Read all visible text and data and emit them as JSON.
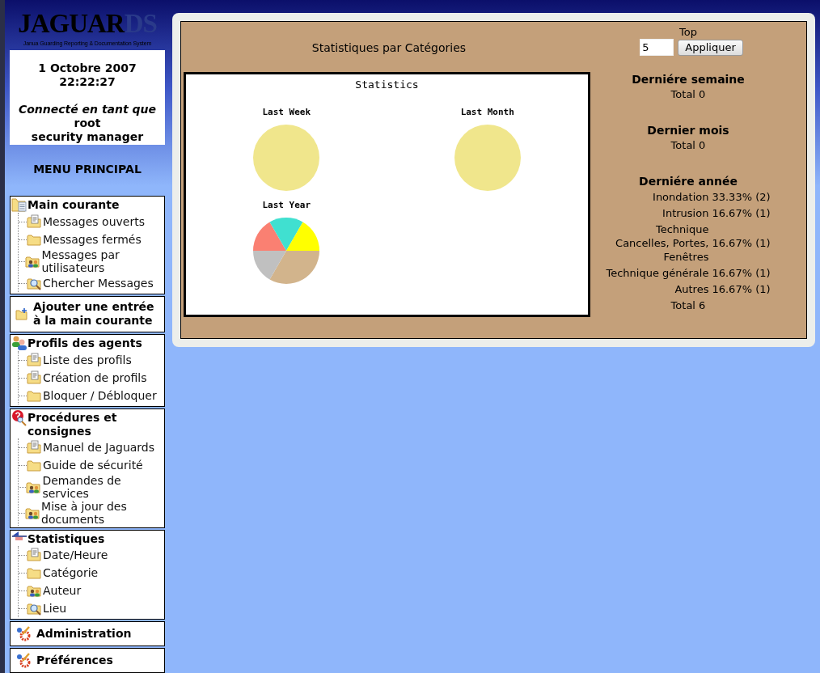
{
  "logo": {
    "main": "JAGUAR",
    "accent": "DS",
    "subtitle": "Janua Guarding Reporting & Documentation System"
  },
  "info": {
    "date": "1 Octobre 2007",
    "time": "22:22:27",
    "connected": "Connecté en tant que",
    "user": "root",
    "role": "security manager"
  },
  "menu_title": "MENU PRINCIPAL",
  "menu": [
    {
      "label": "Main courante",
      "kind": "folder-doc",
      "children": [
        {
          "label": "Messages ouverts",
          "kind": "doc"
        },
        {
          "label": "Messages fermés",
          "kind": "plain"
        },
        {
          "label": "Messages par utilisateurs",
          "kind": "users"
        },
        {
          "label": "Chercher Messages",
          "kind": "search"
        }
      ]
    },
    {
      "label": "Ajouter une entrée à la main courante",
      "kind": "folder-add"
    },
    {
      "label": "Profils des agents",
      "kind": "people",
      "children": [
        {
          "label": "Liste des profils",
          "kind": "doc"
        },
        {
          "label": "Création de profils",
          "kind": "doc"
        },
        {
          "label": "Bloquer / Débloquer",
          "kind": "plain"
        }
      ]
    },
    {
      "label": "Procédures et consignes",
      "kind": "help",
      "children": [
        {
          "label": "Manuel de Jaguards",
          "kind": "doc"
        },
        {
          "label": "Guide de sécurité",
          "kind": "plain"
        },
        {
          "label": "Demandes de services",
          "kind": "users"
        },
        {
          "label": "Mise à jour des documents",
          "kind": "users"
        }
      ]
    },
    {
      "label": "Statistiques",
      "kind": "flag",
      "children": [
        {
          "label": "Date/Heure",
          "kind": "doc"
        },
        {
          "label": "Catégorie",
          "kind": "plain"
        },
        {
          "label": "Auteur",
          "kind": "users"
        },
        {
          "label": "Lieu",
          "kind": "search"
        }
      ]
    },
    {
      "label": "Administration",
      "kind": "tools"
    },
    {
      "label": "Préférences",
      "kind": "tools"
    }
  ],
  "page_title": "Statistiques par Catégories",
  "top": {
    "label": "Top",
    "value": "5",
    "button": "Appliquer"
  },
  "chart_panel": {
    "title": "Statistics",
    "pies": [
      {
        "title": "Last Week",
        "kind": "empty"
      },
      {
        "title": "Last Month",
        "kind": "empty"
      },
      {
        "title": "Last Year",
        "kind": "chart",
        "chart_data": {
          "type": "pie",
          "values": [
            33.33,
            16.67,
            16.67,
            16.67,
            16.67
          ]
        }
      }
    ]
  },
  "summary": [
    {
      "heading": "Derniére semaine",
      "total": "Total 0"
    },
    {
      "heading": "Dernier mois",
      "total": "Total 0"
    },
    {
      "heading": "Derniére année",
      "rows": [
        {
          "category": [
            "Inondation"
          ],
          "value": "33.33% (2)"
        },
        {
          "category": [
            "Intrusion"
          ],
          "value": "16.67% (1)"
        },
        {
          "category": [
            "Technique",
            "Cancelles, Portes,",
            "Fenêtres"
          ],
          "value": "16.67% (1)"
        },
        {
          "category": [
            "Technique générale"
          ],
          "value": "16.67% (1)"
        },
        {
          "category": [
            "Autres"
          ],
          "value": "16.67% (1)"
        }
      ],
      "total": "Total 6"
    }
  ]
}
